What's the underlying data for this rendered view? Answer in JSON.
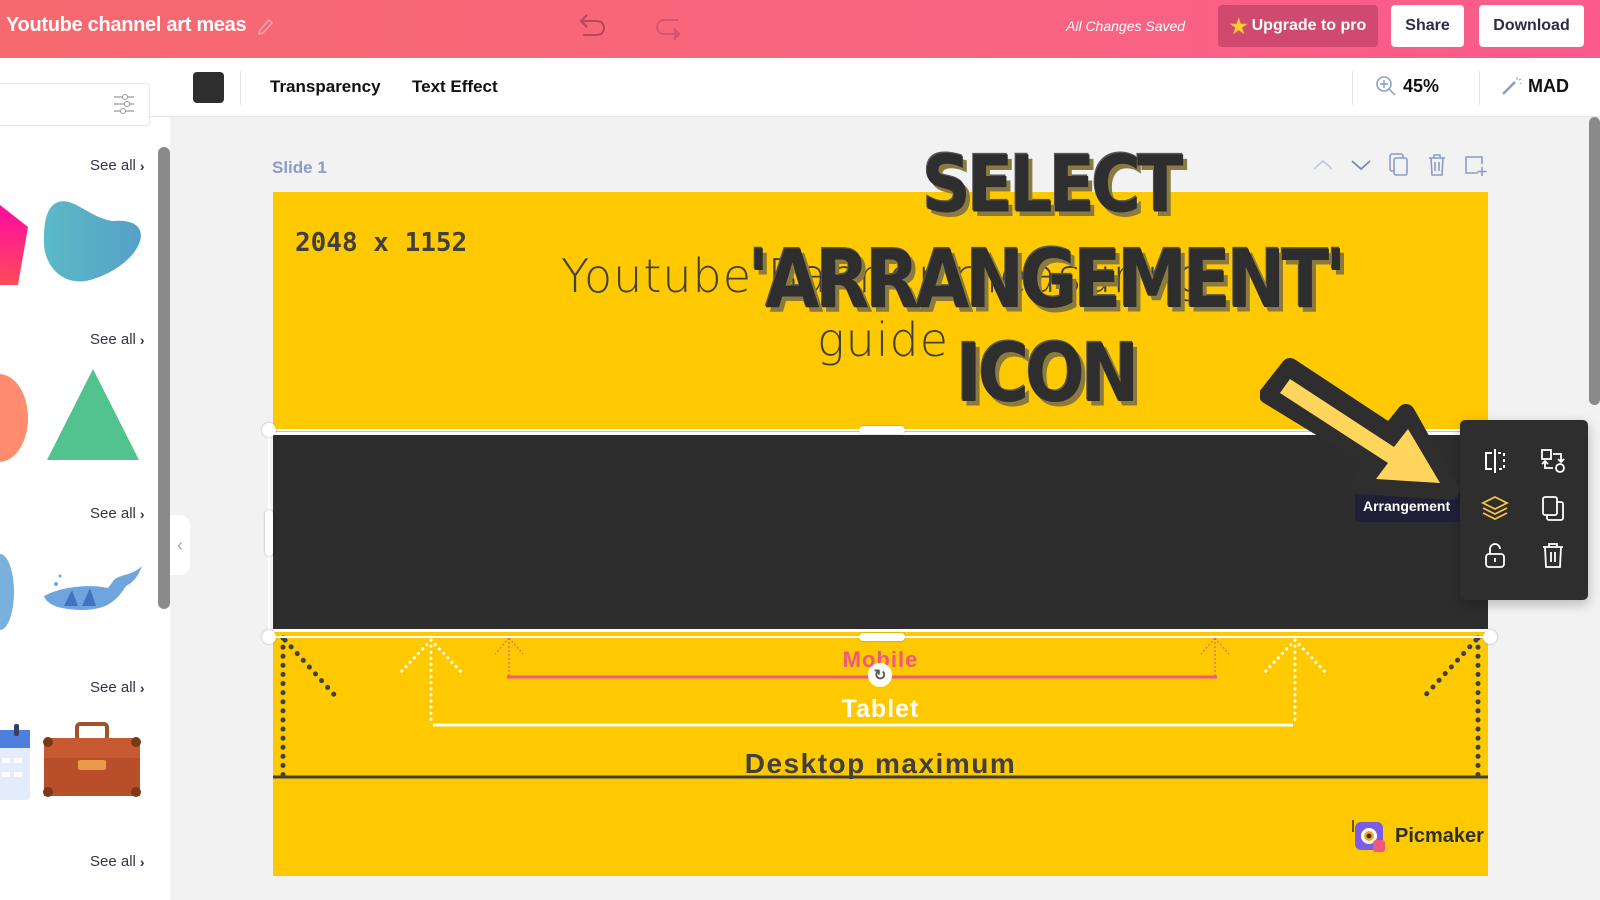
{
  "header": {
    "doc_title": "Youtube channel art meas",
    "save_status": "All Changes Saved",
    "upgrade_label": "Upgrade to pro",
    "share_label": "Share",
    "download_label": "Download",
    "icons": [
      "pencil-icon",
      "undo-icon",
      "redo-icon",
      "star-icon"
    ]
  },
  "toolbar": {
    "text_color": "#2e2e2e",
    "transparency_label": "Transparency",
    "text_effect_label": "Text Effect",
    "zoom_level": "45%",
    "magic_label": "MAD"
  },
  "sidebar": {
    "search_placeholder": "",
    "sections": [
      {
        "see_all": "See all",
        "items": [
          "pentagon-shape",
          "blob-shape"
        ]
      },
      {
        "see_all": "See all",
        "items": [
          "circle-shape",
          "triangle-shape"
        ]
      },
      {
        "see_all": "See all",
        "items": [
          "animal-illustration",
          "whale-illustration"
        ]
      },
      {
        "see_all": "See all",
        "items": [
          "calendar-illustration",
          "briefcase-illustration"
        ]
      },
      {
        "see_all": "See all",
        "items": []
      }
    ]
  },
  "canvas": {
    "slide_label": "Slide 1",
    "slide_controls": [
      "move-up",
      "move-down",
      "duplicate",
      "delete",
      "add-slide"
    ]
  },
  "slide": {
    "dimensions": "2048 x 1152",
    "banner_title": "Youtube Banner measuring guide",
    "mobile_label": "Mobile",
    "tablet_label": "Tablet",
    "desktop_label": "Desktop maximum",
    "logo_text": "Picmaker",
    "colors": {
      "background": "#ffc900",
      "dark_band": "#2d2d2d",
      "mobile": "#f2577c",
      "tablet": "#ffffff",
      "desktop": "#404040"
    }
  },
  "annotation": {
    "line1": "SELECT",
    "line2": "'ARRANGEMENT'",
    "line3": "ICON"
  },
  "context_menu": {
    "tooltip": "Arrangement",
    "buttons": [
      "flip",
      "replace",
      "arrangement",
      "duplicate",
      "lock",
      "delete"
    ],
    "active_button": "arrangement",
    "active_color": "#f5c542"
  }
}
